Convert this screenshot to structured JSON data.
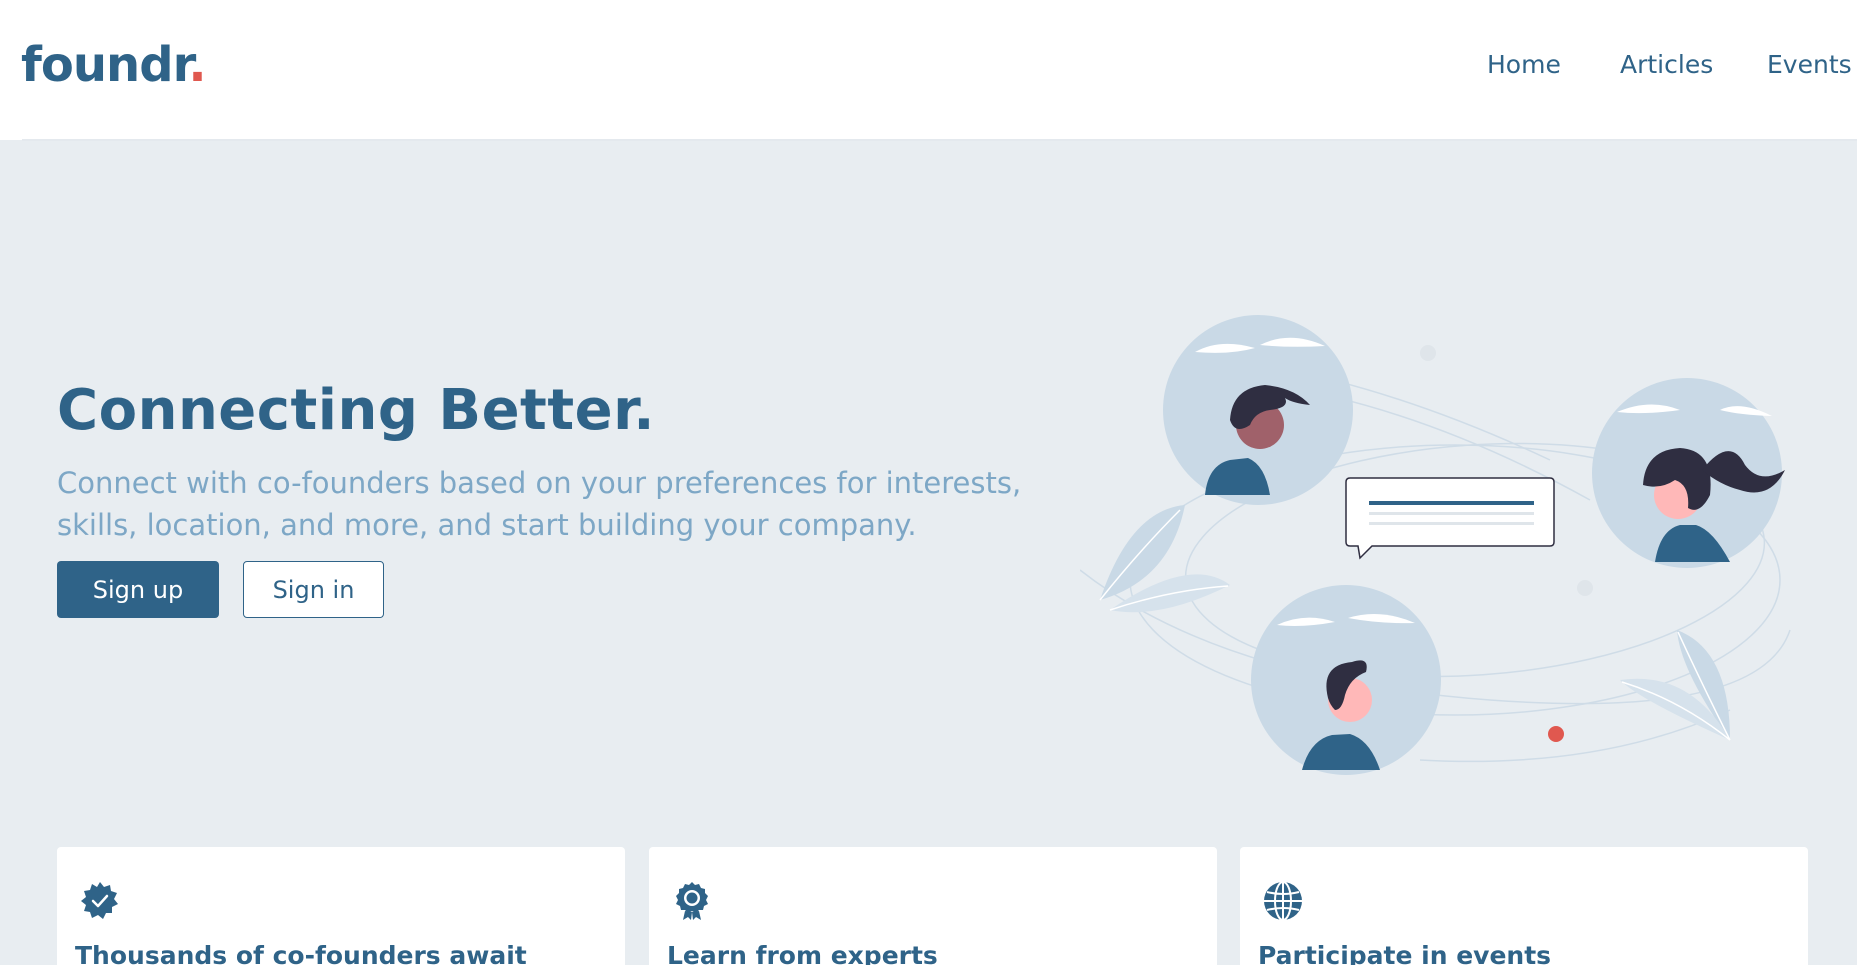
{
  "brand": {
    "name": "foundr",
    "dot": "."
  },
  "nav": {
    "home": "Home",
    "articles": "Articles",
    "events": "Events"
  },
  "hero": {
    "title": "Connecting Better.",
    "subtitle": "Connect with co-founders based on your preferences for interests, skills, location, and more, and start building your company.",
    "signup_label": "Sign up",
    "signin_label": "Sign in"
  },
  "features": [
    {
      "icon": "verified-badge-icon",
      "title": "Thousands of co-founders await"
    },
    {
      "icon": "award-ribbon-icon",
      "title": "Learn from experts"
    },
    {
      "icon": "globe-icon",
      "title": "Participate in events"
    }
  ],
  "colors": {
    "primary": "#2f6388",
    "accent": "#e0584f",
    "background": "#e8edf1",
    "muted": "#7da7c6",
    "avatar_bg": "#c9d9e6"
  }
}
